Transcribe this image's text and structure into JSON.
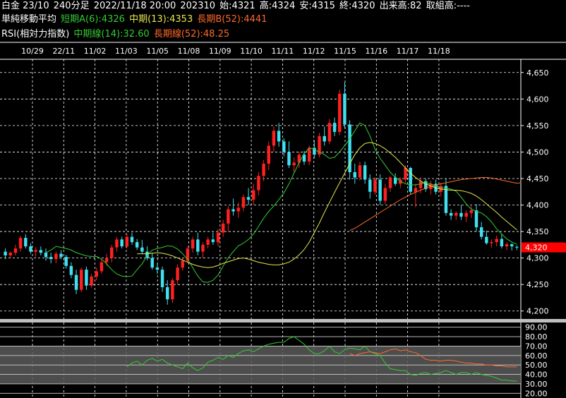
{
  "header": {
    "instrument": "白金 23/10",
    "interval": "240分足",
    "datetime": "2022/11/18 20:00",
    "contract": "202310",
    "open": "始:4321",
    "high": "高:4324",
    "low": "安:4315",
    "close": "終:4320",
    "volume": "出来高:82",
    "oi": "取組高:----"
  },
  "ma_legend": {
    "title": "単純移動平均",
    "short": "短期A(6):4326",
    "mid": "中期(13):4353",
    "long": "長期B(52):4441"
  },
  "rsi_legend": {
    "title": "RSI(相対力指数)",
    "mid": "中期線(14):32.60",
    "long": "長期線(52):48.25"
  },
  "colors": {
    "up": "#ff2020",
    "down": "#40e0f0",
    "ma_short": "#33cc33",
    "ma_mid": "#e6e64d",
    "ma_long": "#ff6a2a",
    "rsi_mid": "#33cc33",
    "rsi_long": "#ff6a2a",
    "price_tag": "#ff0000"
  },
  "chart_data": [
    {
      "type": "candlestick",
      "x_labels": [
        "10/29",
        "22/11",
        "11/02",
        "11/03",
        "11/05",
        "11/08",
        "11/09",
        "11/10",
        "11/11",
        "11/12",
        "11/15",
        "11/16",
        "11/17",
        "11/18"
      ],
      "y_ticks": [
        "4,650",
        "4,600",
        "4,550",
        "4,500",
        "4,450",
        "4,400",
        "4,350",
        "4,300",
        "4,250",
        "4,200"
      ],
      "ylim": [
        4185,
        4675
      ],
      "grid": true,
      "last_price_label": "4,320",
      "last_price": 4320,
      "candles": [
        [
          4312,
          4318,
          4298,
          4305
        ],
        [
          4305,
          4312,
          4300,
          4310
        ],
        [
          4310,
          4325,
          4305,
          4318
        ],
        [
          4318,
          4342,
          4312,
          4338
        ],
        [
          4338,
          4345,
          4318,
          4322
        ],
        [
          4322,
          4328,
          4308,
          4312
        ],
        [
          4312,
          4320,
          4302,
          4315
        ],
        [
          4315,
          4322,
          4305,
          4310
        ],
        [
          4310,
          4318,
          4295,
          4302
        ],
        [
          4302,
          4310,
          4290,
          4298
        ],
        [
          4298,
          4312,
          4290,
          4308
        ],
        [
          4308,
          4315,
          4298,
          4302
        ],
        [
          4302,
          4306,
          4280,
          4285
        ],
        [
          4285,
          4292,
          4262,
          4268
        ],
        [
          4268,
          4278,
          4232,
          4240
        ],
        [
          4240,
          4282,
          4236,
          4278
        ],
        [
          4278,
          4284,
          4240,
          4248
        ],
        [
          4248,
          4270,
          4244,
          4265
        ],
        [
          4265,
          4282,
          4258,
          4275
        ],
        [
          4275,
          4298,
          4270,
          4292
        ],
        [
          4292,
          4308,
          4285,
          4300
        ],
        [
          4300,
          4325,
          4292,
          4320
        ],
        [
          4320,
          4340,
          4312,
          4335
        ],
        [
          4335,
          4340,
          4318,
          4322
        ],
        [
          4322,
          4345,
          4318,
          4340
        ],
        [
          4340,
          4348,
          4325,
          4330
        ],
        [
          4330,
          4336,
          4315,
          4320
        ],
        [
          4320,
          4334,
          4308,
          4312
        ],
        [
          4312,
          4322,
          4296,
          4300
        ],
        [
          4300,
          4310,
          4278,
          4282
        ],
        [
          4282,
          4290,
          4270,
          4278
        ],
        [
          4278,
          4284,
          4236,
          4245
        ],
        [
          4245,
          4258,
          4212,
          4222
        ],
        [
          4222,
          4262,
          4215,
          4258
        ],
        [
          4258,
          4288,
          4250,
          4282
        ],
        [
          4282,
          4300,
          4276,
          4295
        ],
        [
          4295,
          4322,
          4290,
          4318
        ],
        [
          4318,
          4340,
          4310,
          4335
        ],
        [
          4335,
          4348,
          4305,
          4312
        ],
        [
          4312,
          4330,
          4300,
          4325
        ],
        [
          4325,
          4340,
          4318,
          4335
        ],
        [
          4335,
          4348,
          4325,
          4330
        ],
        [
          4330,
          4355,
          4322,
          4348
        ],
        [
          4348,
          4372,
          4340,
          4365
        ],
        [
          4365,
          4398,
          4350,
          4392
        ],
        [
          4392,
          4412,
          4380,
          4388
        ],
        [
          4388,
          4405,
          4376,
          4395
        ],
        [
          4395,
          4420,
          4388,
          4415
        ],
        [
          4415,
          4432,
          4400,
          4410
        ],
        [
          4410,
          4440,
          4400,
          4428
        ],
        [
          4428,
          4462,
          4418,
          4455
        ],
        [
          4455,
          4485,
          4445,
          4478
        ],
        [
          4478,
          4520,
          4466,
          4512
        ],
        [
          4512,
          4548,
          4500,
          4540
        ],
        [
          4540,
          4555,
          4510,
          4520
        ],
        [
          4520,
          4526,
          4492,
          4500
        ],
        [
          4500,
          4520,
          4470,
          4475
        ],
        [
          4475,
          4490,
          4462,
          4480
        ],
        [
          4480,
          4500,
          4470,
          4495
        ],
        [
          4495,
          4502,
          4476,
          4482
        ],
        [
          4482,
          4512,
          4475,
          4508
        ],
        [
          4508,
          4522,
          4488,
          4495
        ],
        [
          4495,
          4536,
          4490,
          4530
        ],
        [
          4530,
          4548,
          4512,
          4520
        ],
        [
          4520,
          4562,
          4515,
          4555
        ],
        [
          4555,
          4565,
          4530,
          4538
        ],
        [
          4538,
          4618,
          4532,
          4610
        ],
        [
          4610,
          4632,
          4545,
          4552
        ],
        [
          4552,
          4560,
          4448,
          4462
        ],
        [
          4462,
          4478,
          4440,
          4452
        ],
        [
          4452,
          4482,
          4446,
          4475
        ],
        [
          4475,
          4482,
          4440,
          4448
        ],
        [
          4448,
          4458,
          4412,
          4425
        ],
        [
          4425,
          4452,
          4420,
          4448
        ],
        [
          4448,
          4458,
          4400,
          4408
        ],
        [
          4408,
          4440,
          4402,
          4432
        ],
        [
          4432,
          4455,
          4425,
          4452
        ],
        [
          4452,
          4460,
          4436,
          4440
        ],
        [
          4440,
          4452,
          4432,
          4448
        ],
        [
          4448,
          4475,
          4442,
          4470
        ],
        [
          4470,
          4472,
          4420,
          4425
        ],
        [
          4425,
          4440,
          4396,
          4432
        ],
        [
          4432,
          4452,
          4422,
          4445
        ],
        [
          4445,
          4450,
          4425,
          4430
        ],
        [
          4430,
          4446,
          4420,
          4440
        ],
        [
          4440,
          4448,
          4420,
          4425
        ],
        [
          4425,
          4442,
          4416,
          4436
        ],
        [
          4436,
          4450,
          4380,
          4385
        ],
        [
          4385,
          4392,
          4372,
          4380
        ],
        [
          4380,
          4388,
          4372,
          4385
        ],
        [
          4385,
          4400,
          4372,
          4378
        ],
        [
          4378,
          4390,
          4368,
          4385
        ],
        [
          4385,
          4398,
          4376,
          4390
        ],
        [
          4390,
          4402,
          4350,
          4358
        ],
        [
          4358,
          4368,
          4335,
          4340
        ],
        [
          4340,
          4352,
          4325,
          4328
        ],
        [
          4328,
          4335,
          4320,
          4330
        ],
        [
          4330,
          4342,
          4322,
          4336
        ],
        [
          4336,
          4346,
          4318,
          4322
        ],
        [
          4322,
          4330,
          4315,
          4326
        ],
        [
          4326,
          4328,
          4314,
          4322
        ],
        [
          4321,
          4324,
          4315,
          4320
        ]
      ],
      "series": [
        {
          "name": "短期A(6)",
          "color": "#33cc33",
          "values": [
            4310,
            4315,
            4322,
            4320,
            4318,
            4315,
            4310,
            4307,
            4304,
            4303,
            4303,
            4298,
            4289,
            4278,
            4270,
            4266,
            4265,
            4266,
            4278,
            4289,
            4305,
            4315,
            4318,
            4320,
            4323,
            4322,
            4317,
            4308,
            4297,
            4282,
            4266,
            4255,
            4254,
            4258,
            4268,
            4285,
            4300,
            4312,
            4323,
            4328,
            4335,
            4345,
            4360,
            4375,
            4388,
            4398,
            4410,
            4423,
            4440,
            4460,
            4480,
            4497,
            4508,
            4505,
            4500,
            4495,
            4488,
            4490,
            4500,
            4512,
            4525,
            4540,
            4555,
            4550,
            4530,
            4505,
            4488,
            4475,
            4462,
            4452,
            4445,
            4440,
            4438,
            4438,
            4440,
            4442,
            4440,
            4436,
            4433,
            4432,
            4430,
            4426,
            4415,
            4402,
            4392,
            4388,
            4385,
            4378,
            4368,
            4355,
            4345,
            4336,
            4330,
            4326
          ]
        },
        {
          "name": "中期(13)",
          "color": "#e6e64d",
          "values": [
            4308,
            4308,
            4308,
            4309,
            4310,
            4309,
            4307,
            4304,
            4300,
            4296,
            4292,
            4288,
            4285,
            4283,
            4282,
            4283,
            4286,
            4290,
            4293,
            4296,
            4299,
            4300,
            4298,
            4295,
            4292,
            4290,
            4288,
            4287,
            4287,
            4289,
            4292,
            4298,
            4306,
            4316,
            4330,
            4348,
            4366,
            4386,
            4405,
            4424,
            4442,
            4460,
            4478,
            4495,
            4508,
            4516,
            4518,
            4516,
            4512,
            4506,
            4498,
            4490,
            4480,
            4470,
            4460,
            4452,
            4445,
            4440,
            4436,
            4432,
            4430,
            4429,
            4428,
            4428,
            4427,
            4425,
            4422,
            4417,
            4410,
            4402,
            4394,
            4386,
            4377,
            4369,
            4361,
            4353
          ]
        },
        {
          "name": "長期B(52)",
          "color": "#ff6a2a",
          "values": [
            4352,
            4356,
            4362,
            4368,
            4374,
            4380,
            4386,
            4392,
            4398,
            4404,
            4410,
            4415,
            4420,
            4424,
            4428,
            4432,
            4435,
            4437,
            4440,
            4442,
            4444,
            4446,
            4448,
            4449,
            4450,
            4451,
            4452,
            4452,
            4451,
            4449,
            4447,
            4445,
            4443,
            4441
          ]
        }
      ]
    },
    {
      "type": "line",
      "title": "RSI(相対力指数)",
      "y_ticks": [
        "90.00",
        "80.00",
        "70.00",
        "60.00",
        "50.00",
        "40.00",
        "30.00",
        "20.00"
      ],
      "ylim": [
        15,
        95
      ],
      "bands": [
        [
          30,
          70
        ]
      ],
      "series": [
        {
          "name": "中期線(14)",
          "color": "#33cc33",
          "values": [
            48,
            52,
            54,
            50,
            55,
            57,
            54,
            56,
            52,
            50,
            48,
            46,
            52,
            47,
            44,
            47,
            53,
            55,
            58,
            56,
            60,
            58,
            62,
            65,
            66,
            64,
            67,
            70,
            72,
            73,
            74,
            74,
            78,
            80,
            76,
            72,
            66,
            62,
            62,
            65,
            70,
            64,
            62,
            66,
            68,
            67,
            66,
            70,
            64,
            62,
            60,
            52,
            46,
            45,
            44,
            44,
            40,
            39,
            41,
            42,
            40,
            41,
            42,
            44,
            42,
            40,
            42,
            42,
            40,
            42,
            40,
            39,
            38,
            36,
            34,
            34,
            33,
            33
          ]
        },
        {
          "name": "長期線(52)",
          "color": "#ff6a2a",
          "values": [
            62,
            60,
            62,
            63,
            64,
            63,
            62,
            64,
            66,
            67,
            65,
            66,
            64,
            63,
            60,
            56,
            55,
            55,
            54,
            55,
            55,
            54,
            53,
            52,
            52,
            51,
            51,
            50,
            50,
            49,
            49,
            48,
            48,
            48
          ]
        }
      ]
    }
  ]
}
